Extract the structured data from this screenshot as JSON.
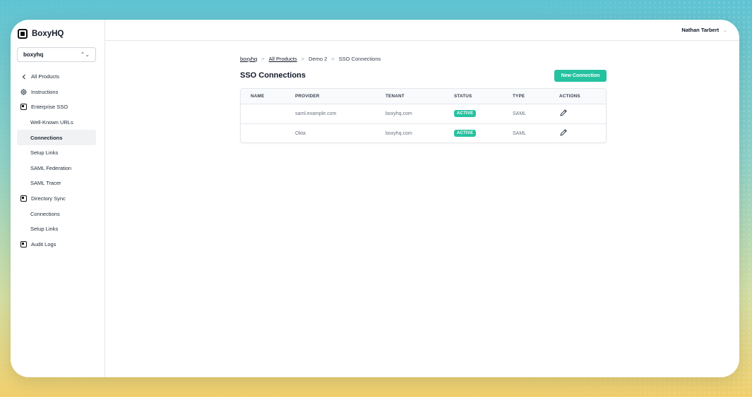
{
  "brand": {
    "name": "BoxyHQ"
  },
  "team_select": {
    "value": "boxyhq"
  },
  "header": {
    "user_name": "Nathan Tarbert"
  },
  "sidebar": {
    "items": [
      {
        "label": "All Products",
        "icon": "chevron-left-icon"
      },
      {
        "label": "Instructions",
        "icon": "gear-icon"
      },
      {
        "label": "Enterprise SSO",
        "icon": "sso-icon"
      },
      {
        "label": "Well-Known URLs"
      },
      {
        "label": "Connections",
        "active": true
      },
      {
        "label": "Setup Links"
      },
      {
        "label": "SAML Federation"
      },
      {
        "label": "SAML Tracer"
      },
      {
        "label": "Directory Sync",
        "icon": "directory-icon"
      },
      {
        "label": "Connections"
      },
      {
        "label": "Setup Links"
      },
      {
        "label": "Audit Logs",
        "icon": "audit-icon"
      }
    ]
  },
  "breadcrumb": {
    "items": [
      "boxyhq",
      "All Products",
      "Demo 2",
      "SSO Connections"
    ],
    "separator": ">"
  },
  "main": {
    "title": "SSO Connections",
    "new_button": "New Connection"
  },
  "table": {
    "columns": [
      "NAME",
      "PROVIDER",
      "TENANT",
      "STATUS",
      "TYPE",
      "ACTIONS"
    ],
    "rows": [
      {
        "name": "",
        "provider": "saml.example.com",
        "tenant": "boxyhq.com",
        "status": "ACTIVE",
        "type": "SAML"
      },
      {
        "name": "",
        "provider": "Okta",
        "tenant": "boxyhq.com",
        "status": "ACTIVE",
        "type": "SAML"
      }
    ]
  },
  "colors": {
    "accent": "#25c2a0",
    "text": "#111827",
    "muted": "#6b7280"
  }
}
